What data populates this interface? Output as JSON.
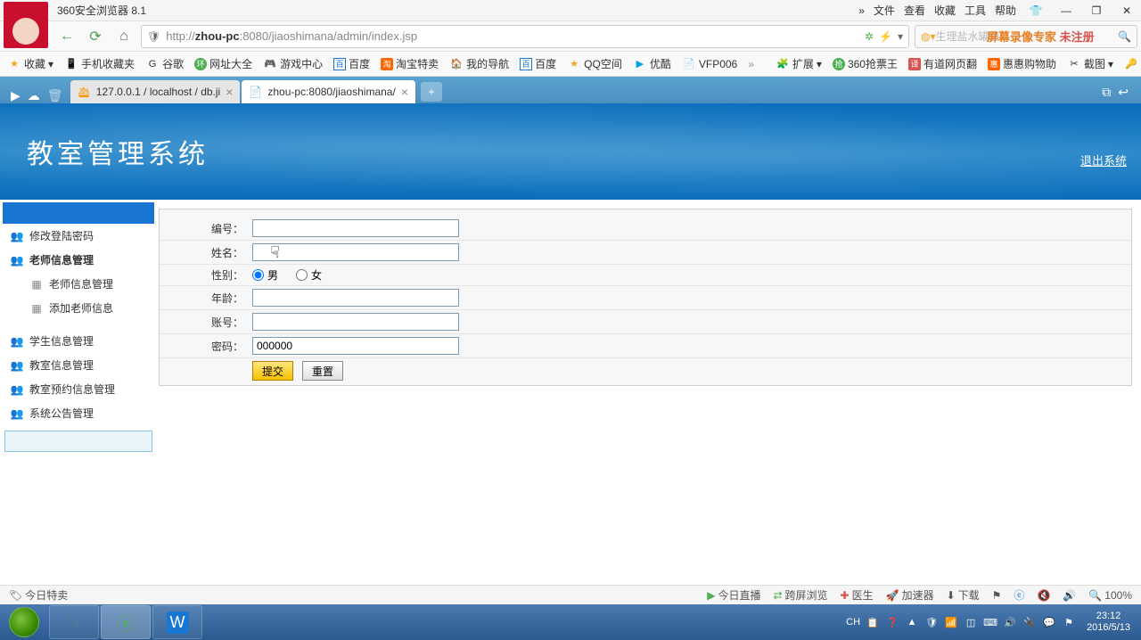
{
  "titlebar": {
    "title": "360安全浏览器 8.1",
    "menus": [
      "文件",
      "查看",
      "收藏",
      "工具",
      "帮助"
    ]
  },
  "navbar": {
    "url_prefix": "http://",
    "url_host": "zhou-pc",
    "url_port": ":8080",
    "url_path": "/jiaoshimana/admin/index.jsp",
    "search_hint": "生理盐水罐装",
    "overlay1": "屏幕录像专家",
    "overlay2": "未注册"
  },
  "bookmarks": {
    "fav": "收藏",
    "items": [
      "手机收藏夹",
      "谷歌",
      "网址大全",
      "游戏中心",
      "百度",
      "淘宝特卖",
      "我的导航",
      "百度",
      "QQ空间",
      "优酷",
      "VFP006"
    ],
    "right": [
      "扩展",
      "360抢票王",
      "有道网页翻",
      "惠惠购物助",
      "截图",
      "登录管家"
    ]
  },
  "tabs": {
    "tab1": "127.0.0.1 / localhost / db.ji",
    "tab2": "zhou-pc:8080/jiaoshimana/"
  },
  "banner": {
    "title": "教室管理系统",
    "logout": "退出系统"
  },
  "sidebar": {
    "items": [
      {
        "label": "修改登陆密码",
        "icon": "people",
        "bold": false,
        "sub": false
      },
      {
        "label": "老师信息管理",
        "icon": "people",
        "bold": true,
        "sub": false
      },
      {
        "label": "老师信息管理",
        "icon": "grid",
        "bold": false,
        "sub": true
      },
      {
        "label": "添加老师信息",
        "icon": "grid",
        "bold": false,
        "sub": true
      },
      {
        "label": "学生信息管理",
        "icon": "people",
        "bold": false,
        "sub": false
      },
      {
        "label": "教室信息管理",
        "icon": "people",
        "bold": false,
        "sub": false
      },
      {
        "label": "教室预约信息管理",
        "icon": "people",
        "bold": false,
        "sub": false
      },
      {
        "label": "系统公告管理",
        "icon": "people",
        "bold": false,
        "sub": false
      }
    ]
  },
  "form": {
    "labels": {
      "id": "编号：",
      "name": "姓名：",
      "gender": "性别：",
      "age": "年龄：",
      "account": "账号：",
      "password": "密码："
    },
    "gender": {
      "male": "男",
      "female": "女"
    },
    "password_value": "000000",
    "submit": "提交",
    "reset": "重置"
  },
  "statusbar": {
    "left": "今日特卖",
    "right": [
      "今日直播",
      "跨屏浏览",
      "医生",
      "加速器",
      "下载",
      "100%"
    ]
  },
  "taskbar": {
    "lang": "CH",
    "time": "23:12",
    "date": "2016/5/13"
  }
}
